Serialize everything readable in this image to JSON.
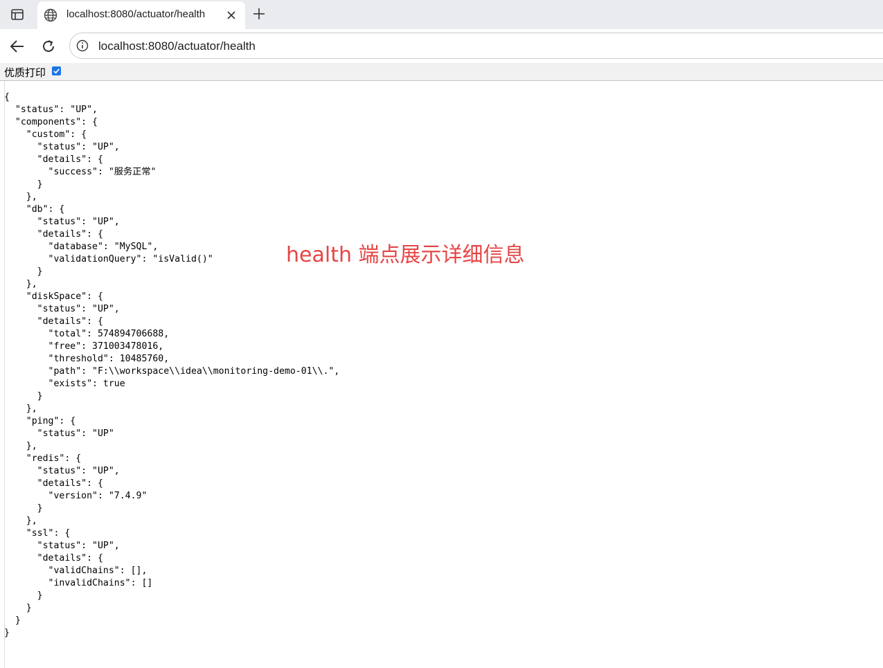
{
  "browser": {
    "tab": {
      "title": "localhost:8080/actuator/health"
    },
    "address": {
      "url": "localhost:8080/actuator/health"
    }
  },
  "pretty_print": {
    "label": "优质打印",
    "checked": true
  },
  "json_text": "{\n  \"status\": \"UP\",\n  \"components\": {\n    \"custom\": {\n      \"status\": \"UP\",\n      \"details\": {\n        \"success\": \"服务正常\"\n      }\n    },\n    \"db\": {\n      \"status\": \"UP\",\n      \"details\": {\n        \"database\": \"MySQL\",\n        \"validationQuery\": \"isValid()\"\n      }\n    },\n    \"diskSpace\": {\n      \"status\": \"UP\",\n      \"details\": {\n        \"total\": 574894706688,\n        \"free\": 371003478016,\n        \"threshold\": 10485760,\n        \"path\": \"F:\\\\workspace\\\\idea\\\\monitoring-demo-01\\\\.\",\n        \"exists\": true\n      }\n    },\n    \"ping\": {\n      \"status\": \"UP\"\n    },\n    \"redis\": {\n      \"status\": \"UP\",\n      \"details\": {\n        \"version\": \"7.4.9\"\n      }\n    },\n    \"ssl\": {\n      \"status\": \"UP\",\n      \"details\": {\n        \"validChains\": [],\n        \"invalidChains\": []\n      }\n    }\n  }\n}",
  "annotation": "health 端点展示详细信息",
  "colors": {
    "annotation": "#e64545",
    "accent": "#1a73e8"
  },
  "icons": {
    "tab_actions": "tab-actions-icon",
    "favicon": "globe-icon",
    "close": "close-icon",
    "new_tab": "plus-icon",
    "back": "back-arrow-icon",
    "reload": "reload-icon",
    "site_info": "info-icon",
    "checkbox": "checkmark-icon"
  }
}
